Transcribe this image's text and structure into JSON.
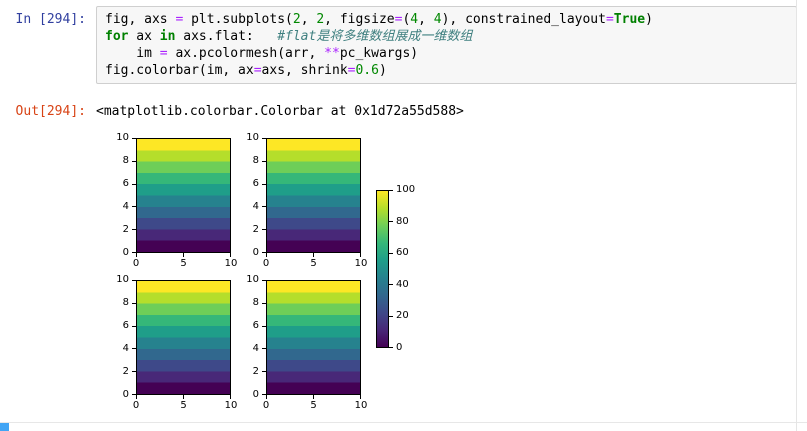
{
  "notebook": {
    "input_cell": {
      "prompt": "In [294]:",
      "code_lines": [
        {
          "tokens": [
            {
              "type": "plain",
              "text": "fig, axs "
            },
            {
              "type": "op",
              "text": "="
            },
            {
              "type": "plain",
              "text": " plt.subplots("
            },
            {
              "type": "num",
              "text": "2"
            },
            {
              "type": "plain",
              "text": ", "
            },
            {
              "type": "num",
              "text": "2"
            },
            {
              "type": "plain",
              "text": ", figsize"
            },
            {
              "type": "op",
              "text": "="
            },
            {
              "type": "plain",
              "text": "("
            },
            {
              "type": "num",
              "text": "4"
            },
            {
              "type": "plain",
              "text": ", "
            },
            {
              "type": "num",
              "text": "4"
            },
            {
              "type": "plain",
              "text": "), constrained_layout"
            },
            {
              "type": "op",
              "text": "="
            },
            {
              "type": "kw",
              "text": "True"
            },
            {
              "type": "plain",
              "text": ")"
            }
          ]
        },
        {
          "tokens": [
            {
              "type": "kw",
              "text": "for"
            },
            {
              "type": "plain",
              "text": " ax "
            },
            {
              "type": "kw",
              "text": "in"
            },
            {
              "type": "plain",
              "text": " axs.flat:   "
            },
            {
              "type": "comment",
              "text": "#flat是将多维数组展成一维数组"
            }
          ]
        },
        {
          "tokens": [
            {
              "type": "plain",
              "text": "    im "
            },
            {
              "type": "op",
              "text": "="
            },
            {
              "type": "plain",
              "text": " ax.pcolormesh(arr, "
            },
            {
              "type": "op",
              "text": "**"
            },
            {
              "type": "plain",
              "text": "pc_kwargs)"
            }
          ]
        },
        {
          "tokens": [
            {
              "type": "plain",
              "text": "fig.colorbar(im, ax"
            },
            {
              "type": "op",
              "text": "="
            },
            {
              "type": "plain",
              "text": "axs, shrink"
            },
            {
              "type": "op",
              "text": "="
            },
            {
              "type": "num",
              "text": "0.6"
            },
            {
              "type": "plain",
              "text": ")"
            }
          ]
        }
      ]
    },
    "output_cell": {
      "prompt": "Out[294]:",
      "text_output": "<matplotlib.colorbar.Colorbar at 0x1d72a55d588>"
    }
  },
  "figure": {
    "ytick_labels": [
      "10",
      "8",
      "6",
      "4",
      "2",
      "0"
    ],
    "xtick_labels": [
      "0",
      "5",
      "10"
    ],
    "colorbar_labels": [
      "100",
      "80",
      "60",
      "40",
      "20",
      "0"
    ]
  },
  "colors": {
    "in_prompt": "#303F9F",
    "out_prompt": "#D84315",
    "keyword": "#008000",
    "number": "#008800",
    "operator": "#AA22FF",
    "comment": "#408080",
    "cell_background": "#f7f7f7",
    "cell_border": "#cfcfcf",
    "selection_blue": "#42A5F5"
  },
  "chart_data": {
    "type": "heatmap",
    "title": "",
    "subplot_grid": [
      2,
      2
    ],
    "subplots_identical": true,
    "x_range": [
      0,
      10
    ],
    "y_range": [
      0,
      10
    ],
    "xticks": [
      0,
      5,
      10
    ],
    "yticks": [
      0,
      2,
      4,
      6,
      8,
      10
    ],
    "value_range": [
      0,
      100
    ],
    "pattern": "horizontal bands increasing in value from 0 at bottom to 100 at top",
    "colormap": "viridis",
    "viridis_stops": [
      "#440154",
      "#482878",
      "#3e4989",
      "#31688e",
      "#26828e",
      "#1f9e89",
      "#35b779",
      "#6ece58",
      "#b5de2b",
      "#fde725"
    ],
    "colorbar": {
      "ticks": [
        0,
        20,
        40,
        60,
        80,
        100
      ],
      "shrink": 0.6,
      "location": "right"
    }
  }
}
